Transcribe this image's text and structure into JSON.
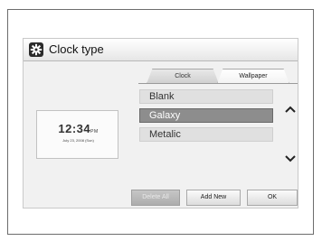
{
  "window": {
    "title": "Clock type",
    "icon": "gear-icon"
  },
  "tabs": [
    {
      "label": "Clock",
      "active": false
    },
    {
      "label": "Wallpaper",
      "active": true
    }
  ],
  "preview": {
    "time": "12:34",
    "ampm": "PM",
    "date": "July 23, 2008 (Sun)"
  },
  "wallpaper_list": [
    {
      "label": "Blank",
      "selected": false
    },
    {
      "label": "Galaxy",
      "selected": true
    },
    {
      "label": "Metalic",
      "selected": false
    }
  ],
  "scroll": {
    "up_icon": "chevron-up-icon",
    "down_icon": "chevron-down-icon"
  },
  "buttons": {
    "delete_all": "Delete All",
    "add_new": "Add New",
    "ok": "OK"
  },
  "colors": {
    "selected_item": "#8d8d8d",
    "item": "#e0e0e0",
    "screen_bg": "#f1f1f1"
  }
}
